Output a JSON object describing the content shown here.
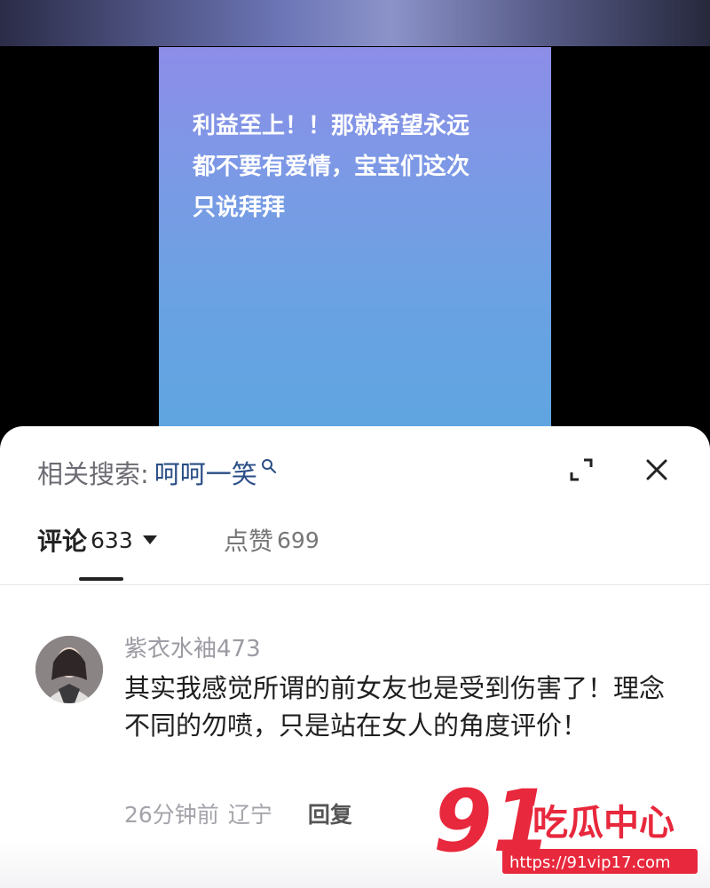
{
  "video": {
    "caption": "利益至上！！那就希望永远都不要有爱情，宝宝们这次只说拜拜"
  },
  "search": {
    "prefix": "相关搜索:",
    "term": "呵呵一笑"
  },
  "tabs": {
    "comments_label": "评论",
    "comments_count": "633",
    "likes_label": "点赞",
    "likes_count": "699"
  },
  "comment": {
    "username": "紫衣水袖473",
    "text": "其实我感觉所谓的前女友也是受到伤害了！理念不同的勿喷，只是站在女人的角度评价！",
    "time": "26分钟前",
    "location": "辽宁",
    "reply_label": "回复"
  },
  "watermark": {
    "number": "91",
    "brand": "吃瓜中心",
    "url": "https://91vip17.com"
  },
  "colors": {
    "search_term": "#2a4d86",
    "watermark_red": "#e8283c"
  }
}
